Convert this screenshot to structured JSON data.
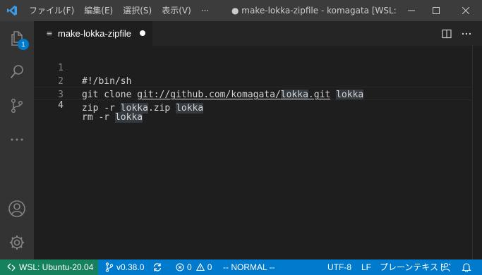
{
  "titlebar": {
    "menu": [
      "ファイル(F)",
      "編集(E)",
      "選択(S)",
      "表示(V)",
      "···"
    ],
    "window_title": "● make-lokka-zipfile - komagata [WSL: ..."
  },
  "activity": {
    "explorer_badge": "1"
  },
  "tab": {
    "label": "make-lokka-zipfile"
  },
  "editor": {
    "line_numbers": [
      "1",
      "2",
      "3",
      "4"
    ],
    "lines": {
      "l1": "#!/bin/sh",
      "l2": {
        "p1": "git clone ",
        "p2": "git://github.com/komagata/",
        "p3": "lokka",
        "p4": ".git",
        "p5": " ",
        "p6": "lokka"
      },
      "l3": {
        "p1": "zip -r ",
        "p2": "lokka",
        "p3": ".zip ",
        "p4": "lokka"
      },
      "l4": {
        "p1": "rm -r ",
        "p2": "lokka"
      }
    }
  },
  "statusbar": {
    "remote": "WSL: Ubuntu-20.04",
    "branch": "v0.38.0",
    "errors": "0",
    "warnings": "0",
    "mode": "-- NORMAL --",
    "encoding": "UTF-8",
    "eol": "LF",
    "language": "プレーンテキスト"
  },
  "colors": {
    "accent": "#007acc",
    "remote": "#16825d",
    "titlebar": "#3c3c3c",
    "activitybar": "#333333",
    "editor_bg": "#1e1e1e"
  }
}
